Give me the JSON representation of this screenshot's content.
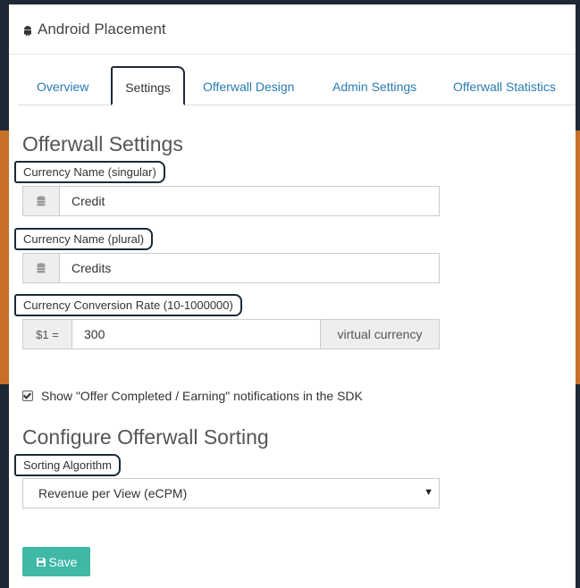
{
  "header": {
    "title": "Android Placement",
    "icon": "android-icon"
  },
  "tabs": [
    {
      "label": "Overview",
      "active": false
    },
    {
      "label": "Settings",
      "active": true
    },
    {
      "label": "Offerwall Design",
      "active": false
    },
    {
      "label": "Admin Settings",
      "active": false
    },
    {
      "label": "Offerwall Statistics",
      "active": false
    }
  ],
  "offerwall_settings": {
    "title": "Offerwall Settings",
    "currency_singular": {
      "label": "Currency Name (singular)",
      "value": "Credit",
      "icon": "database-icon"
    },
    "currency_plural": {
      "label": "Currency Name (plural)",
      "value": "Credits",
      "icon": "database-icon"
    },
    "conversion_rate": {
      "label": "Currency Conversion Rate (10-1000000)",
      "prefix": "$1 =",
      "value": "300",
      "suffix": "virtual currency"
    },
    "notification_checkbox": {
      "label": "Show \"Offer Completed / Earning\" notifications in the SDK",
      "checked": true
    }
  },
  "sorting": {
    "title": "Configure Offerwall Sorting",
    "algorithm_label": "Sorting Algorithm",
    "algorithm_value": "Revenue per View (eCPM)"
  },
  "actions": {
    "save_label": "Save",
    "save_icon": "floppy-disk-icon"
  },
  "colors": {
    "accent": "#3fb8a5",
    "link": "#2a7bb5",
    "background": "#1d2935",
    "band": "#c8702a"
  }
}
